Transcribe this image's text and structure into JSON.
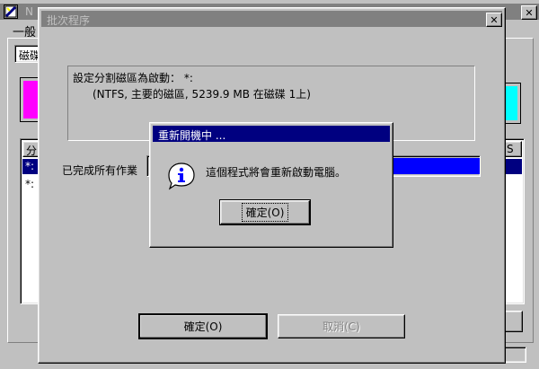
{
  "back_window": {
    "title": "N",
    "tab_label": "一般",
    "field_label": "磁碟",
    "list_header_left": "分",
    "list_header_right": "S",
    "list_rows": [
      "*:",
      "*:"
    ],
    "close_glyph": "✕"
  },
  "batch_dialog": {
    "title": "批次程序",
    "close_glyph": "✕",
    "info_line1": "設定分割磁區為啟動： *:",
    "info_line2": "(NTFS, 主要的磁區, 5239.9 MB  在磁碟 1上)",
    "status_text": "已完成所有作業",
    "progress_fraction": 1.0,
    "ok_button": "確定(O)",
    "cancel_button": "取消(C)"
  },
  "restart_dialog": {
    "title": "重新開機中 ...",
    "icon": "info-icon",
    "message": "這個程式將會重新啟動電腦。",
    "ok_button": "確定(O)"
  },
  "colors": {
    "active_title": "#000080",
    "inactive_title": "#808080",
    "progress": "#0000ff",
    "swatch_magenta": "#ff00ff",
    "swatch_cyan": "#00ffff"
  }
}
